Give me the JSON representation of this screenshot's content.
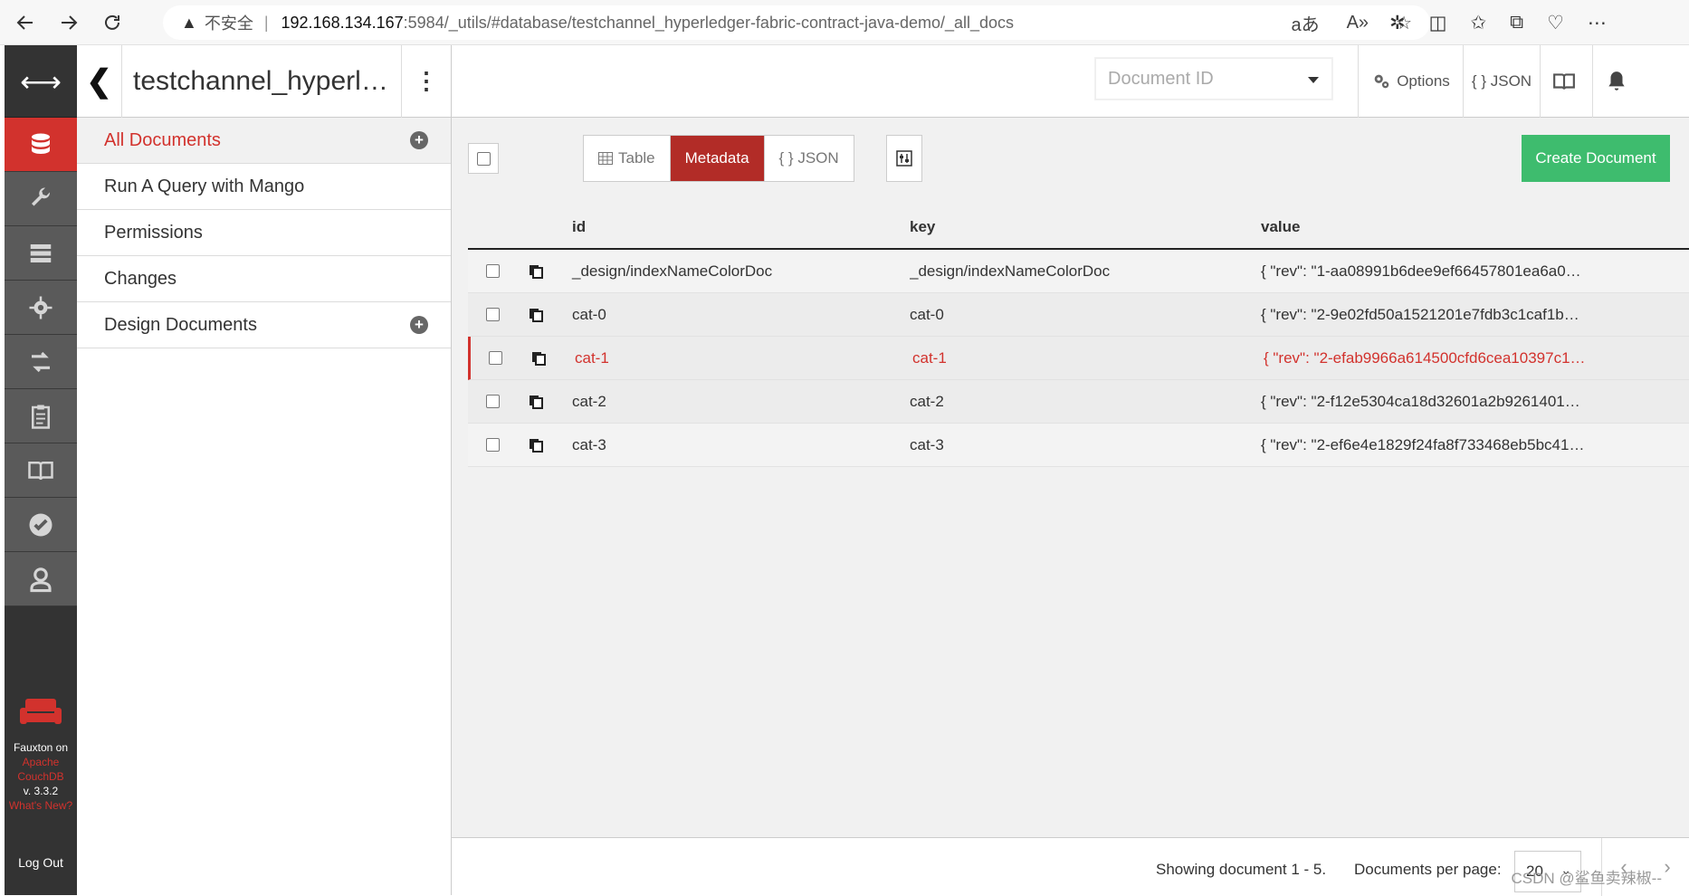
{
  "browser": {
    "warning_label": "不安全",
    "url_host": "192.168.134.167",
    "url_path": ":5984/_utils/#database/testchannel_hyperledger-fabric-contract-java-demo/_all_docs"
  },
  "rail": {
    "logo_line1": "Fauxton on",
    "logo_line2": "Apache",
    "logo_line3": "CouchDB",
    "version": "v. 3.3.2",
    "whats_new": "What's New?",
    "logout": "Log Out"
  },
  "db": {
    "name": "testchannel_hyperl…"
  },
  "subnav": {
    "items": [
      {
        "label": "All Documents"
      },
      {
        "label": "Run A Query with Mango"
      },
      {
        "label": "Permissions"
      },
      {
        "label": "Changes"
      },
      {
        "label": "Design Documents"
      }
    ]
  },
  "header": {
    "docid_placeholder": "Document ID",
    "options_label": "Options",
    "json_label": "{ } JSON"
  },
  "toolbar": {
    "table_label": "Table",
    "metadata_label": "Metadata",
    "json_label": "{ } JSON",
    "create_label": "Create Document"
  },
  "table": {
    "columns": [
      "id",
      "key",
      "value"
    ],
    "rows": [
      {
        "id": "_design/indexNameColorDoc",
        "key": "_design/indexNameColorDoc",
        "value": "{ \"rev\": \"1-aa08991b6dee9ef66457801ea6a0…"
      },
      {
        "id": "cat-0",
        "key": "cat-0",
        "value": "{ \"rev\": \"2-9e02fd50a1521201e7fdb3c1caf1b…"
      },
      {
        "id": "cat-1",
        "key": "cat-1",
        "value": "{ \"rev\": \"2-efab9966a614500cfd6cea10397c1…"
      },
      {
        "id": "cat-2",
        "key": "cat-2",
        "value": "{ \"rev\": \"2-f12e5304ca18d32601a2b9261401…"
      },
      {
        "id": "cat-3",
        "key": "cat-3",
        "value": "{ \"rev\": \"2-ef6e4e1829f24fa8f733468eb5bc41…"
      }
    ]
  },
  "footer": {
    "showing": "Showing document 1 - 5.",
    "per_page_label": "Documents per page:",
    "per_page_value": "20",
    "watermark": "CSDN @鲨鱼卖辣椒--"
  },
  "colors": {
    "accent_red": "#d2322d",
    "create_green": "#3ebc6e",
    "rail_bg": "#333333"
  }
}
